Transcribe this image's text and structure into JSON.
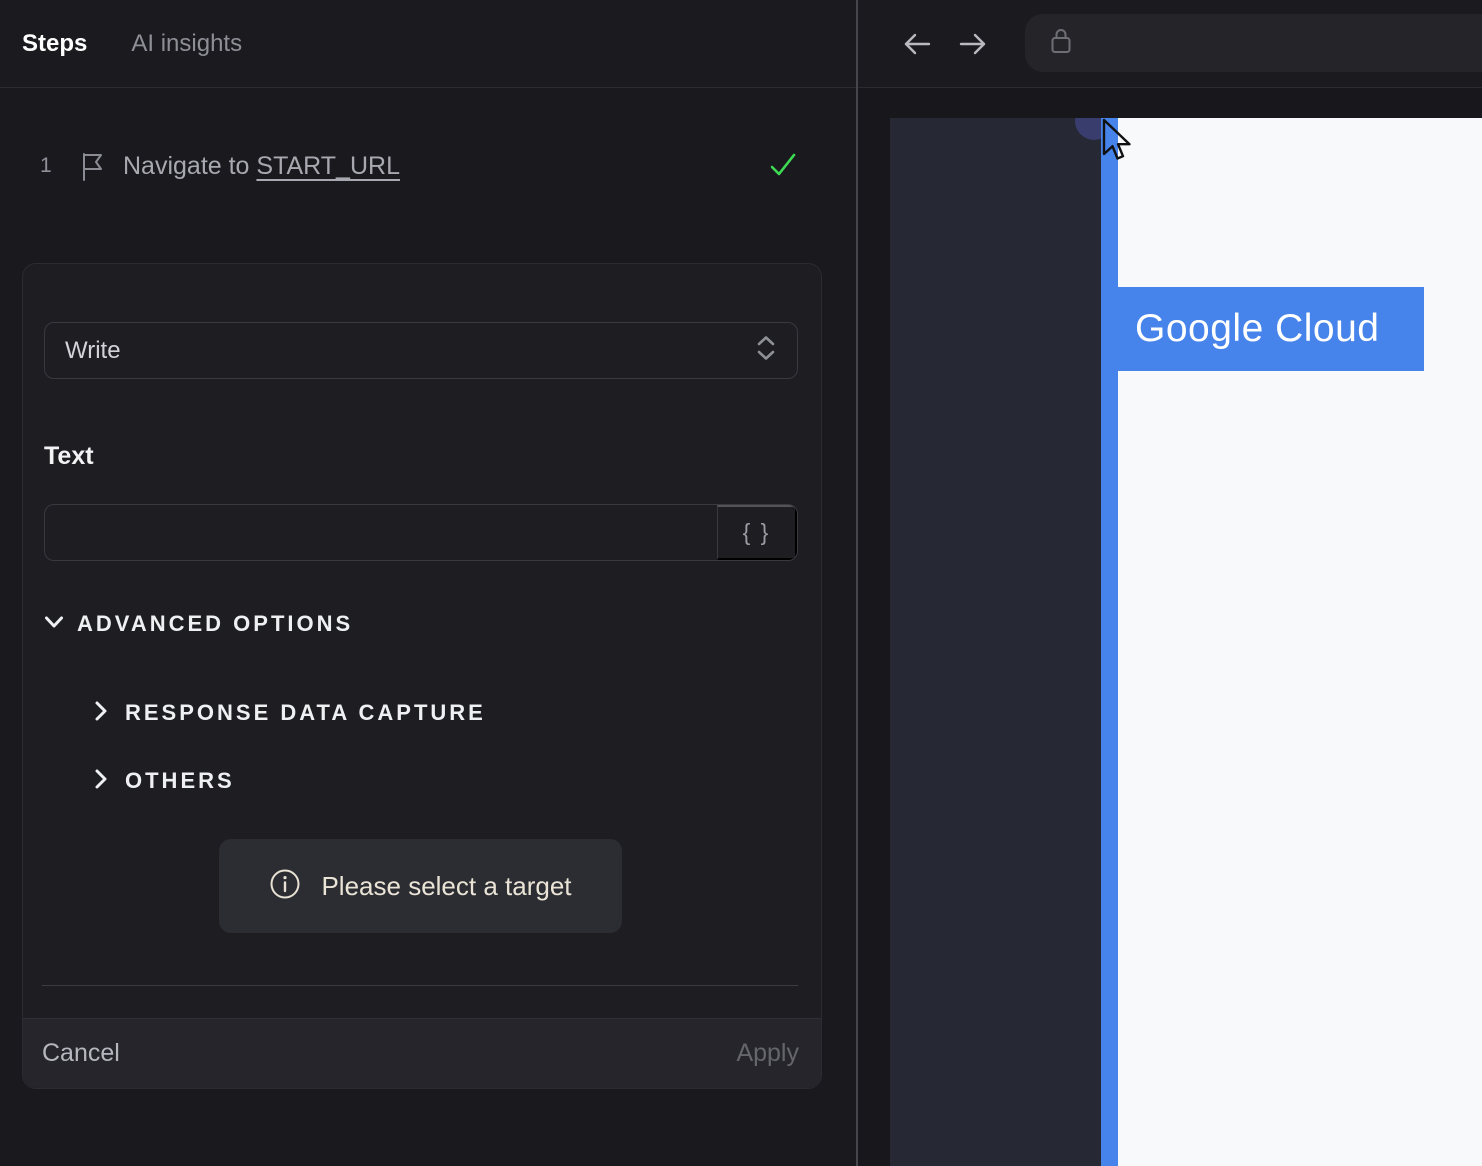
{
  "left_panel": {
    "tabs": [
      {
        "label": "Steps",
        "active": true
      },
      {
        "label": "AI insights",
        "active": false
      }
    ],
    "step": {
      "index": "1",
      "text": "Navigate to ",
      "link": "START_URL"
    },
    "editor": {
      "action_select": {
        "value": "Write"
      },
      "text_field": {
        "label": "Text",
        "value": "",
        "variables_button": "{ }"
      },
      "advanced_options_label": "ADVANCED OPTIONS",
      "sections": [
        {
          "label": "RESPONSE DATA CAPTURE"
        },
        {
          "label": "OTHERS"
        }
      ],
      "notice": "Please select a target",
      "footer": {
        "cancel": "Cancel",
        "apply": "Apply"
      }
    }
  },
  "browser": {
    "page": {
      "highlight_label": "Google Cloud"
    }
  },
  "colors": {
    "accent_blue": "#4683eb",
    "success_green": "#3ddb53",
    "page_sidebar": "#262834",
    "page_background": "#f8f9fa",
    "panel_background": "#1a1a1e",
    "notice_text": "#eae4d6"
  }
}
